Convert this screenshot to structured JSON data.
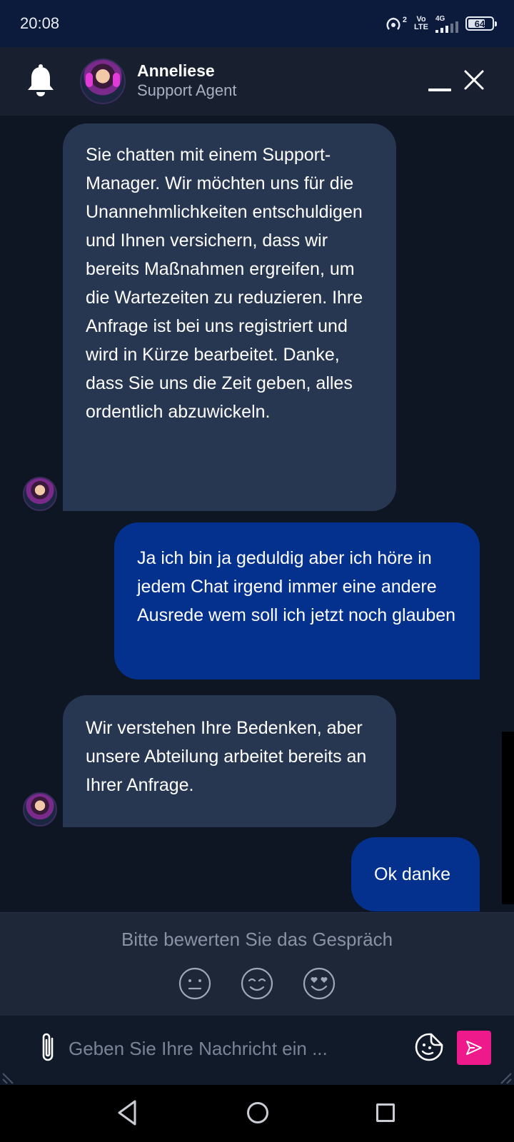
{
  "status_bar": {
    "time": "20:08",
    "volte_top": "Vo",
    "volte_bottom": "LTE",
    "hotspot_count": "2",
    "network": "4G",
    "battery": "64"
  },
  "header": {
    "agent_name": "Anneliese",
    "agent_role": "Support Agent"
  },
  "messages": [
    {
      "from": "agent",
      "text": "Sie chatten mit einem Support-Manager. Wir möchten uns für die Unannehmlichkeiten entschuldigen und Ihnen versichern, dass wir bereits Maßnahmen ergreifen, um die Wartezeiten zu reduzieren. Ihre Anfrage ist bei uns registriert und wird in Kürze bearbeitet. Danke, dass Sie uns die Zeit geben, alles ordentlich abzuwickeln."
    },
    {
      "from": "user",
      "text": "Ja ich bin ja geduldig aber ich höre in jedem Chat irgend immer eine andere Ausrede wem soll ich jetzt noch glauben"
    },
    {
      "from": "agent",
      "text": "Wir verstehen Ihre Bedenken, aber unsere Abteilung arbeitet bereits an Ihrer Anfrage."
    },
    {
      "from": "user",
      "text": "Ok danke"
    }
  ],
  "rating": {
    "title": "Bitte bewerten Sie das Gespräch",
    "options": [
      "neutral-face-icon",
      "smiling-face-icon",
      "heart-eyes-face-icon"
    ]
  },
  "composer": {
    "placeholder": "Geben Sie Ihre Nachricht ein ..."
  },
  "colors": {
    "background": "#0f1623",
    "agent_bubble": "#283751",
    "user_bubble": "#03318d",
    "send_button": "#ee1a8b",
    "status_bar": "#0c1a3b"
  }
}
